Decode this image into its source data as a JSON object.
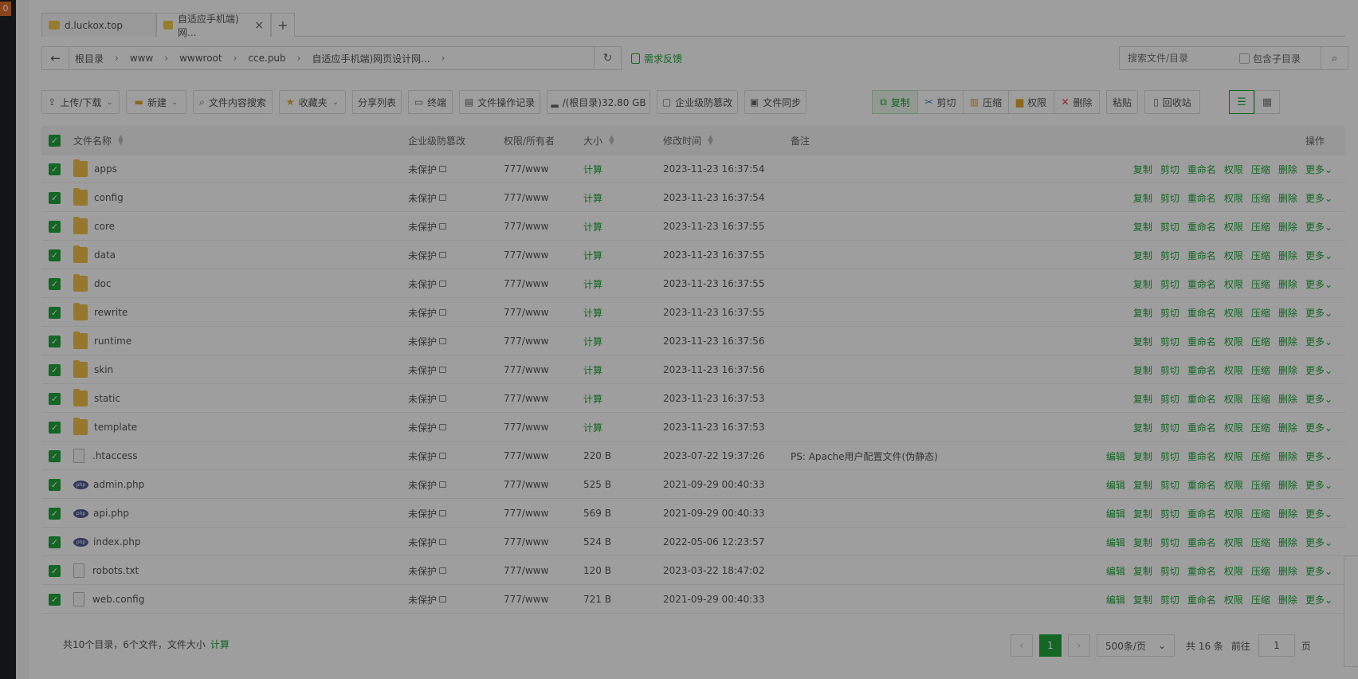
{
  "sidebar": {
    "badge": "0"
  },
  "tabs": [
    {
      "label": "d.luckox.top"
    },
    {
      "label": "自适应手机端)网...",
      "close": "×"
    }
  ],
  "tab_add": "+",
  "path": {
    "back": "←",
    "crumbs": [
      "根目录",
      "www",
      "wwwroot",
      "cce.pub",
      "自适应手机端)网页设计网..."
    ],
    "sep": "›"
  },
  "refresh": "↻",
  "feedback": "需求反馈",
  "search": {
    "placeholder": "搜索文件/目录",
    "include_sub": "包含子目录",
    "icon": "search-icon"
  },
  "toolbar": {
    "upload": "上传/下载",
    "new": "新建",
    "content_search": "文件内容搜索",
    "favorites": "收藏夹",
    "share_list": "分享列表",
    "terminal": "终端",
    "op_log": "文件操作记录",
    "disk": "/(根目录)32.80 GB",
    "tamper": "企业级防篡改",
    "sync": "文件同步",
    "copy": "复制",
    "cut": "剪切",
    "compress": "压缩",
    "perm": "权限",
    "delete": "删除",
    "paste": "粘贴",
    "recycle": "回收站"
  },
  "table": {
    "headers": {
      "name": "文件名称",
      "tamper": "企业级防篡改",
      "perm": "权限/所有者",
      "size": "大小",
      "mtime": "修改时间",
      "note": "备注",
      "ops": "操作"
    },
    "rows": [
      {
        "name": "apps",
        "type": "folder",
        "tamper": "未保护",
        "perm": "777/www",
        "size": "计算",
        "mtime": "2023-11-23 16:37:54",
        "note": ""
      },
      {
        "name": "config",
        "type": "folder",
        "tamper": "未保护",
        "perm": "777/www",
        "size": "计算",
        "mtime": "2023-11-23 16:37:54",
        "note": ""
      },
      {
        "name": "core",
        "type": "folder",
        "tamper": "未保护",
        "perm": "777/www",
        "size": "计算",
        "mtime": "2023-11-23 16:37:55",
        "note": ""
      },
      {
        "name": "data",
        "type": "folder",
        "tamper": "未保护",
        "perm": "777/www",
        "size": "计算",
        "mtime": "2023-11-23 16:37:55",
        "note": ""
      },
      {
        "name": "doc",
        "type": "folder",
        "tamper": "未保护",
        "perm": "777/www",
        "size": "计算",
        "mtime": "2023-11-23 16:37:55",
        "note": ""
      },
      {
        "name": "rewrite",
        "type": "folder",
        "tamper": "未保护",
        "perm": "777/www",
        "size": "计算",
        "mtime": "2023-11-23 16:37:55",
        "note": ""
      },
      {
        "name": "runtime",
        "type": "folder",
        "tamper": "未保护",
        "perm": "777/www",
        "size": "计算",
        "mtime": "2023-11-23 16:37:56",
        "note": ""
      },
      {
        "name": "skin",
        "type": "folder",
        "tamper": "未保护",
        "perm": "777/www",
        "size": "计算",
        "mtime": "2023-11-23 16:37:56",
        "note": ""
      },
      {
        "name": "static",
        "type": "folder",
        "tamper": "未保护",
        "perm": "777/www",
        "size": "计算",
        "mtime": "2023-11-23 16:37:53",
        "note": ""
      },
      {
        "name": "template",
        "type": "folder",
        "tamper": "未保护",
        "perm": "777/www",
        "size": "计算",
        "mtime": "2023-11-23 16:37:53",
        "note": ""
      },
      {
        "name": ".htaccess",
        "type": "file",
        "tamper": "未保护",
        "perm": "777/www",
        "size": "220 B",
        "mtime": "2023-07-22 19:37:26",
        "note": "PS: Apache用户配置文件(伪静态)"
      },
      {
        "name": "admin.php",
        "type": "php",
        "tamper": "未保护",
        "perm": "777/www",
        "size": "525 B",
        "mtime": "2021-09-29 00:40:33",
        "note": ""
      },
      {
        "name": "api.php",
        "type": "php",
        "tamper": "未保护",
        "perm": "777/www",
        "size": "569 B",
        "mtime": "2021-09-29 00:40:33",
        "note": ""
      },
      {
        "name": "index.php",
        "type": "php",
        "tamper": "未保护",
        "perm": "777/www",
        "size": "524 B",
        "mtime": "2022-05-06 12:23:57",
        "note": ""
      },
      {
        "name": "robots.txt",
        "type": "file",
        "tamper": "未保护",
        "perm": "777/www",
        "size": "120 B",
        "mtime": "2023-03-22 18:47:02",
        "note": ""
      },
      {
        "name": "web.config",
        "type": "file",
        "tamper": "未保护",
        "perm": "777/www",
        "size": "721 B",
        "mtime": "2021-09-29 00:40:33",
        "note": ""
      }
    ],
    "folder_ops": [
      "复制",
      "剪切",
      "重命名",
      "权限",
      "压缩",
      "删除",
      "更多"
    ],
    "file_ops": [
      "编辑",
      "复制",
      "剪切",
      "重命名",
      "权限",
      "压缩",
      "删除",
      "更多"
    ]
  },
  "footer": {
    "summary": "共10个目录，6个文件，文件大小",
    "calc": "计算",
    "current_page": "1",
    "page_size": "500条/页",
    "total": "共 16 条",
    "goto": "前往",
    "goto_value": "1",
    "page_unit": "页"
  },
  "colors": {
    "accent": "#20a53a",
    "folder": "#f0c24a"
  },
  "php_badge": "php"
}
